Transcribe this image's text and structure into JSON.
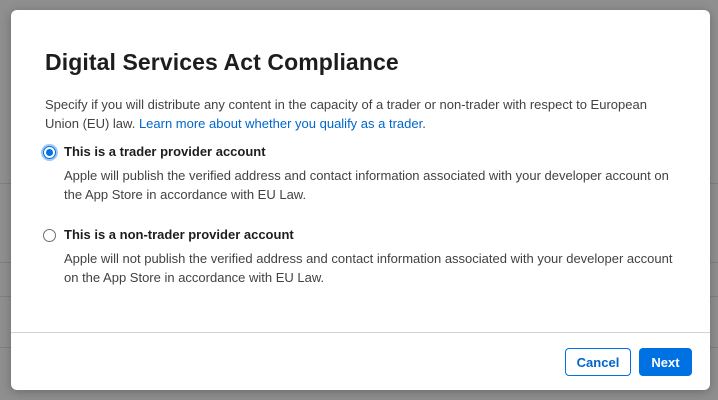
{
  "dialog": {
    "title": "Digital Services Act Compliance",
    "intro_text": "Specify if you will distribute any content in the capacity of a trader or non-trader with respect to European Union (EU) law.",
    "learn_more_link": "Learn more about whether you qualify as a trader",
    "intro_suffix": ".",
    "options": [
      {
        "label": "This is a trader provider account",
        "description": "Apple will publish the verified address and contact information associated with your developer account on the App Store in accordance with EU Law.",
        "selected": true
      },
      {
        "label": "This is a non-trader provider account",
        "description": "Apple will not publish the verified address and contact information associated with your developer account on the App Store in accordance with EU Law.",
        "selected": false
      }
    ],
    "buttons": {
      "cancel": "Cancel",
      "next": "Next"
    }
  },
  "colors": {
    "accent": "#0071e3",
    "link": "#0066cc",
    "overlay": "#8f8f8f"
  }
}
